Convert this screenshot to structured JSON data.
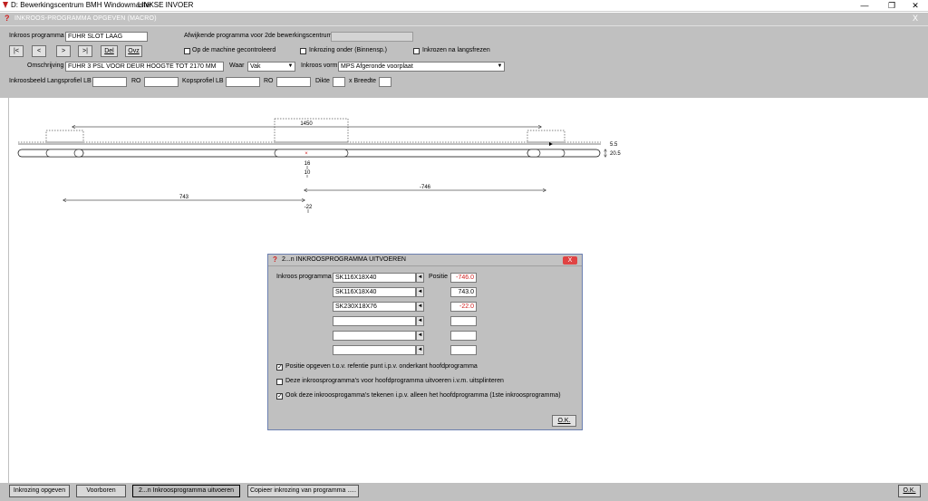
{
  "window": {
    "title": "D: Bewerkingscentrum BMH Windowmaster",
    "subtitle": "LINKSE INVOER",
    "minimize": "—",
    "restore": "❐",
    "close": "✕"
  },
  "inner_window": {
    "title": "INKROOS-PROGRAMMA OPGEVEN (MACRO)",
    "close": "X"
  },
  "form": {
    "inkroos_programma_label": "Inkroos programma",
    "inkroos_programma_value": "FUHR SLOT LAAG",
    "afwijkende_label": "Afwijkende programma voor 2de bewerkingscentrum",
    "afwijkende_value": "",
    "nav_first": "|<",
    "nav_prev": "<",
    "nav_next": ">",
    "nav_last": ">|",
    "del": "Del",
    "ovz": "Ovz",
    "op_machine_label": "Op de machine gecontroleerd",
    "inkrozing_onder_label": "Inkrozing onder (Binnensp.)",
    "inkrozen_na_label": "Inkrozen na langsfrezen",
    "omschrijving_label": "Omschrijving",
    "omschrijving_value": "FUHR 3 PSL VOOR DEUR HOOGTE TOT 2170 MM",
    "waar_label": "Waar",
    "waar_value": "Vak",
    "inkroos_vorm_label": "Inkroos vorm",
    "inkroos_vorm_value": "MPS Afgeronde voorplaat",
    "inkroosbeeld_label": "Inkroosbeeld Langsprofiel LB",
    "ro1_label": "RO",
    "kopsprofiel_label": "Kopsprofiel LB",
    "ro2_label": "RO",
    "dikte_label": "Dikte",
    "breedte_label": "x Breedte"
  },
  "drawing": {
    "dim_top": "1450",
    "dim_right_top": "5.5",
    "dim_right_side": "20.5",
    "center_marks": [
      "16",
      "10"
    ],
    "dim_left": "743",
    "dim_right": "-746",
    "dim_bottom": "-22"
  },
  "dialog": {
    "title": "2...n   INKROOSPROGRAMMA UITVOEREN",
    "close": "X",
    "inkroos_label": "Inkroos programma",
    "positie_label": "Positie",
    "rows": [
      {
        "program": "SK116X18X40",
        "position": "-746.0",
        "neg": true
      },
      {
        "program": "SK116X18X40",
        "position": "743.0",
        "neg": false
      },
      {
        "program": "SK230X18X76",
        "position": "-22.0",
        "neg": true
      },
      {
        "program": "",
        "position": "",
        "neg": false
      },
      {
        "program": "",
        "position": "",
        "neg": false
      },
      {
        "program": "",
        "position": "",
        "neg": false
      }
    ],
    "spin_glyph": "◄",
    "cb1_label": "Positie opgeven t.o.v. refentie punt i.p.v. onderkant hoofdprogramma",
    "cb2_label": "Deze inkroosprogramma's voor hoofdprogramma uitvoeren i.v.m. uitsplinteren",
    "cb3_label": "Ook deze inkroosprogamma's tekenen i.p.v. alleen het hoofdprogramma (1ste inkroosprogramma)",
    "ok": "O.K."
  },
  "bottom": {
    "inkrozing_opgeven": "Inkrozing opgeven",
    "voorboren": "Voorboren",
    "uitvoeren": "2...n   Inkroosprogramma uitvoeren",
    "copieer": "Copieer inkrozing van programma .....",
    "ok": "O.K."
  },
  "colors": {
    "panel": "#c0c0c0",
    "negative": "#d02020",
    "dialog_close": "#e04343"
  }
}
